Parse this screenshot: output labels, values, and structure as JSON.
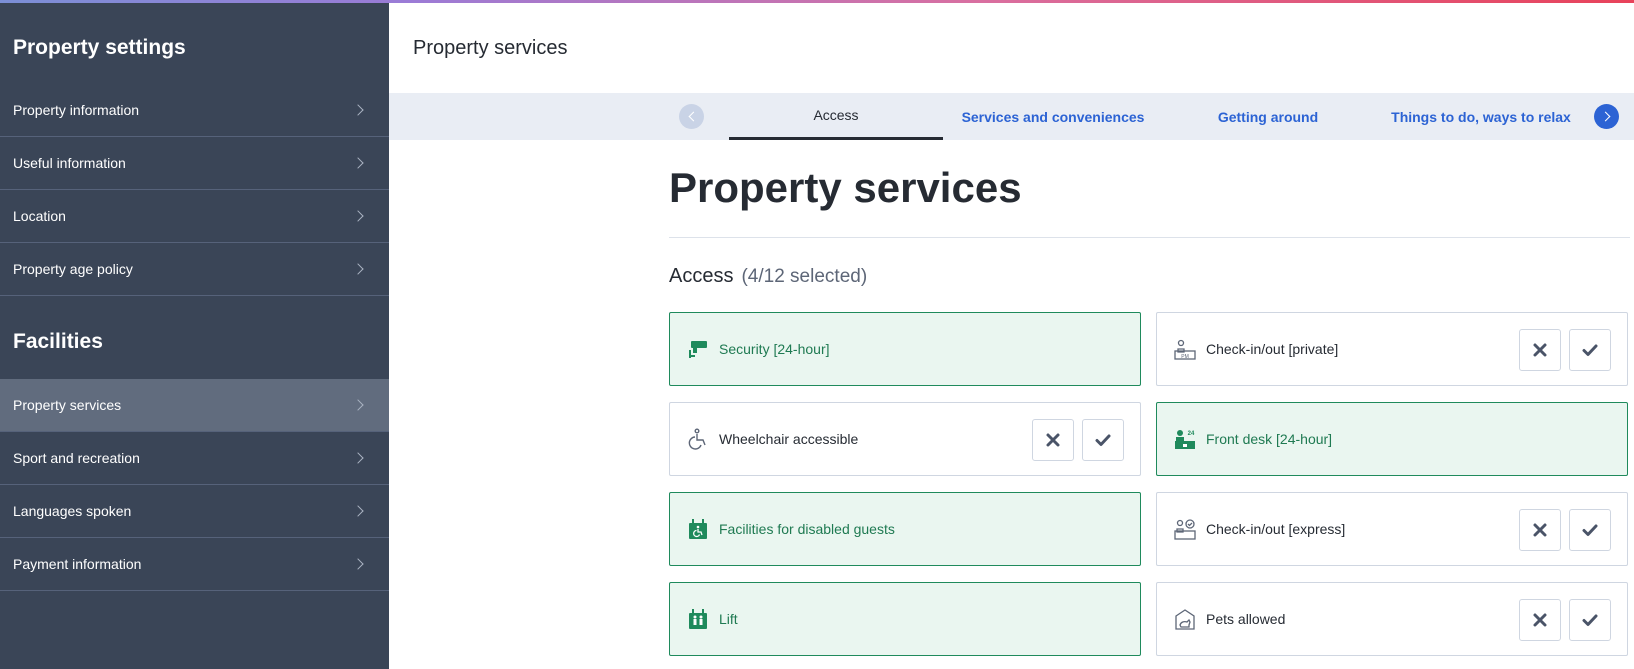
{
  "sidebar": {
    "heading_settings": "Property settings",
    "settings_items": [
      {
        "label": "Property information"
      },
      {
        "label": "Useful information"
      },
      {
        "label": "Location"
      },
      {
        "label": "Property age policy"
      }
    ],
    "heading_facilities": "Facilities",
    "facility_items": [
      {
        "label": "Property services",
        "active": true
      },
      {
        "label": "Sport and recreation"
      },
      {
        "label": "Languages spoken"
      },
      {
        "label": "Payment information"
      }
    ]
  },
  "header": {
    "title": "Property services"
  },
  "tabs": [
    {
      "label": "Access",
      "active": true
    },
    {
      "label": "Services and conveniences"
    },
    {
      "label": "Getting around"
    },
    {
      "label": "Things to do, ways to relax"
    }
  ],
  "main": {
    "title": "Property services",
    "section": {
      "title": "Access",
      "count": "(4/12 selected)"
    }
  },
  "facilities": [
    {
      "label": "Security [24-hour]",
      "selected": true,
      "icon": "security-camera-icon"
    },
    {
      "label": "Check-in/out [private]",
      "selected": false,
      "icon": "private-checkin-icon"
    },
    {
      "label": "Wheelchair accessible",
      "selected": false,
      "icon": "wheelchair-icon"
    },
    {
      "label": "Front desk [24-hour]",
      "selected": true,
      "icon": "front-desk-icon"
    },
    {
      "label": "Facilities for disabled guests",
      "selected": true,
      "icon": "disabled-facilities-icon"
    },
    {
      "label": "Check-in/out [express]",
      "selected": false,
      "icon": "express-checkin-icon"
    },
    {
      "label": "Lift",
      "selected": true,
      "icon": "lift-icon"
    },
    {
      "label": "Pets allowed",
      "selected": false,
      "icon": "pets-icon"
    }
  ],
  "colors": {
    "sidebar_bg": "#3a4557",
    "sidebar_active": "#616c7e",
    "accent_blue": "#2c63d4",
    "selected_green": "#1f8a5c",
    "selected_bg": "#eaf6f0"
  }
}
